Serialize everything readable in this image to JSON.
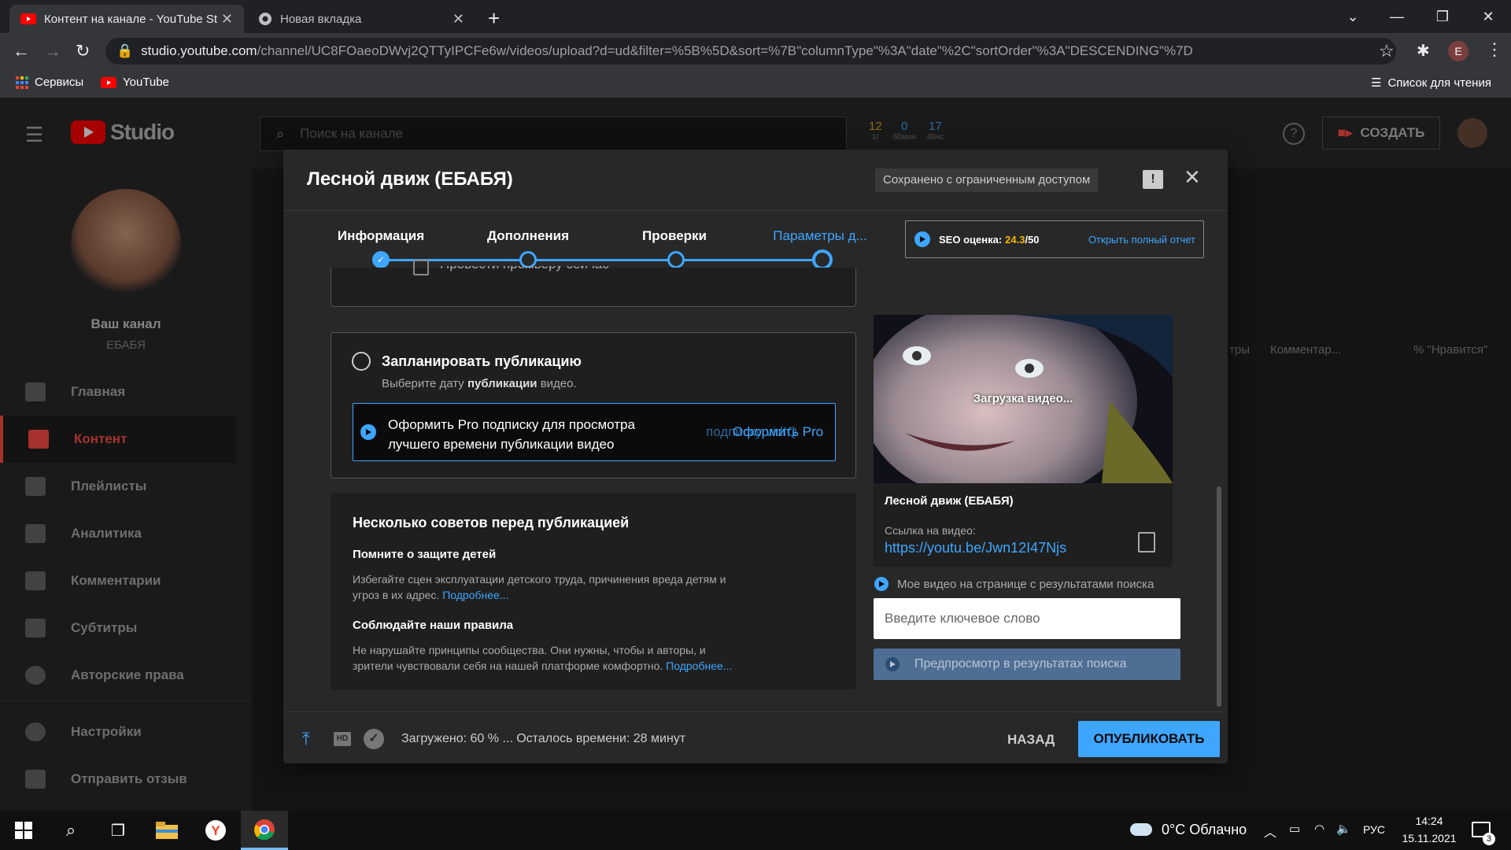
{
  "browser": {
    "tabs": [
      {
        "title": "Контент на канале - YouTube St"
      },
      {
        "title": "Новая вкладка"
      }
    ],
    "url_host": "studio.youtube.com",
    "url_path": "/channel/UC8FOaeoDWvj2QTTyIPCFe6w/videos/upload?d=ud&filter=%5B%5D&sort=%7B\"columnType\"%3A\"date\"%2C\"sortOrder\"%3A\"DESCENDING\"%7D",
    "bookmarks": [
      "Сервисы",
      "YouTube"
    ],
    "reading_list": "Список для чтения",
    "profile_initial": "E"
  },
  "studio": {
    "logo_text": "Studio",
    "search_placeholder": "Поиск на канале",
    "stats": [
      {
        "value": "12",
        "label": "1г"
      },
      {
        "value": "0",
        "label": "60мин"
      },
      {
        "value": "17",
        "label": "48чс"
      }
    ],
    "create_label": "СОЗДАТЬ",
    "channel_label": "Ваш канал",
    "channel_name": "ЕБАБЯ",
    "nav": [
      "Главная",
      "Контент",
      "Плейлисты",
      "Аналитика",
      "Комментарии",
      "Субтитры",
      "Авторские права",
      "Настройки",
      "Отправить отзыв"
    ],
    "bg_columns": [
      "тры",
      "Комментар...",
      "% \"Нравится\""
    ]
  },
  "dialog": {
    "title": "Лесной движ (ЕБАБЯ)",
    "saved_status": "Сохранено с ограниченным доступом",
    "steps": [
      "Информация",
      "Дополнения",
      "Проверки",
      "Параметры д..."
    ],
    "seo_label": "SEO оценка:",
    "seo_score": "24.3",
    "seo_max": "/50",
    "seo_link": "Открыть полный отчет",
    "cutoff_text": "Провести премьеру сейчас",
    "schedule": {
      "title": "Запланировать публикацию",
      "sub_pre": "Выберите дату ",
      "sub_bold": "публикации",
      "sub_post": " видео."
    },
    "pro_banner": {
      "text_line1": "Оформить Pro подписку для просмотра",
      "text_line2": "лучшего времени публикации видео",
      "link": "Оформить Pro",
      "link_ghost": "подписку vidIQ"
    },
    "tips": {
      "heading": "Несколько советов перед публикацией",
      "items": [
        {
          "title": "Помните о защите детей",
          "text_line1": "Избегайте сцен эксплуатации детского труда, причинения вреда детям и",
          "text_line2": "угроз в их адрес.",
          "more": "Подробнее..."
        },
        {
          "title": "Соблюдайте наши правила",
          "text_line1": "Не нарушайте принципы сообщества. Они нужны, чтобы и авторы, и",
          "text_line2": "зрители чувствовали себя на нашей платформе комфортно.",
          "more": "Подробнее..."
        }
      ]
    },
    "preview": {
      "loading": "Загрузка видео...",
      "video_title": "Лесной движ (ЕБАБЯ)",
      "link_label": "Ссылка на видео:",
      "link": "https://youtu.be/Jwn12I47Njs"
    },
    "search_result_label": "Мое видео на странице с результатами поиска",
    "keyword_placeholder": "Введите ключевое слово",
    "preview_btn": "Предпросмотр в результатах поиска",
    "footer": {
      "status": "Загружено: 60 % ... Осталось времени: 28 минут",
      "back": "НАЗАД",
      "publish": "ОПУБЛИКОВАТЬ"
    }
  },
  "taskbar": {
    "weather": "0°C  Облачно",
    "lang": "РУС",
    "time": "14:24",
    "date": "15.11.2021",
    "notifications": "3"
  },
  "colors": {
    "accent": "#3ea6ff",
    "youtube_red": "#ff0000",
    "studio_red": "#ff4e45",
    "seo_score": "#f4b400"
  }
}
